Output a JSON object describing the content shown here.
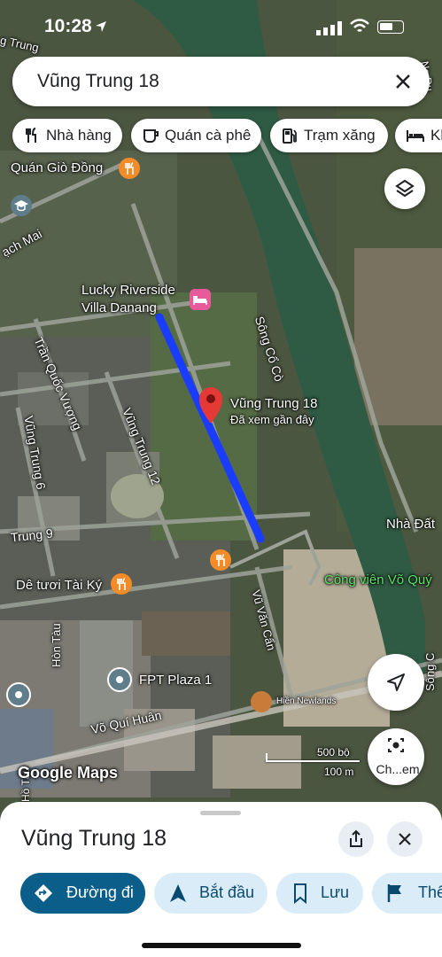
{
  "status": {
    "time": "10:28"
  },
  "search": {
    "query": "Vũng Trung 18"
  },
  "chips": [
    {
      "label": "Nhà hàng",
      "icon": "restaurant-icon"
    },
    {
      "label": "Quán cà phê",
      "icon": "coffee-icon"
    },
    {
      "label": "Trạm xăng",
      "icon": "gas-station-icon"
    },
    {
      "label": "Kh",
      "icon": "hotel-icon"
    }
  ],
  "map_labels": {
    "quan_gio_dong": "Quán Giò Đồng",
    "lucky_line1": "Lucky Riverside",
    "lucky_line2": "Villa Danang",
    "song_co_co": "Sông Cổ Cò",
    "selected_name": "Vũng Trung 18",
    "selected_sub": "Đã xem gần đây",
    "tran_quoc_vuong": "Trần Quốc Vượng",
    "vung_trung_12": "Vũng Trung 12",
    "vung_trung_6": "Vũng Trung 6",
    "vung_trung_9": "Trung 9",
    "nha_dat": "Nhà Đất",
    "cong_vien": "Công viên Võ Quý",
    "de_tuoi": "Dê tươi Tài Ký",
    "fpt_plaza": "FPT Plaza 1",
    "vu_van_can": "Vũ Văn Cẩn",
    "hien_newlands": "Hiền Newlands",
    "vo_qui_huan": "Võ Quí Huân",
    "hon_tau": "Hòn Tàu",
    "ho_tau": "Hồ Tàu",
    "song_co_edge": "Sông C",
    "ach_mai": "ạch Mai",
    "aung_trung": "g Trung",
    "corner_nd": "Ng Du",
    "google_maps": "Google Maps"
  },
  "scale": {
    "top": "500 bộ",
    "bottom": "100 m"
  },
  "camera_button": {
    "label": "Ch...em"
  },
  "sheet": {
    "title": "Vũng Trung 18",
    "actions": [
      {
        "label": "Đường đi",
        "icon": "directions-icon"
      },
      {
        "label": "Bắt đầu",
        "icon": "navigation-arrow-icon"
      },
      {
        "label": "Lưu",
        "icon": "bookmark-icon"
      },
      {
        "label": "Thê",
        "icon": "flag-icon"
      }
    ]
  },
  "colors": {
    "route": "#1a3cff",
    "pin": "#e53935",
    "river": "#2f5a43",
    "poi_food": "#f28c28",
    "poi_hotel": "#e85a9a",
    "poi_generic": "#607d8b",
    "action_primary": "#0b5e8a"
  }
}
